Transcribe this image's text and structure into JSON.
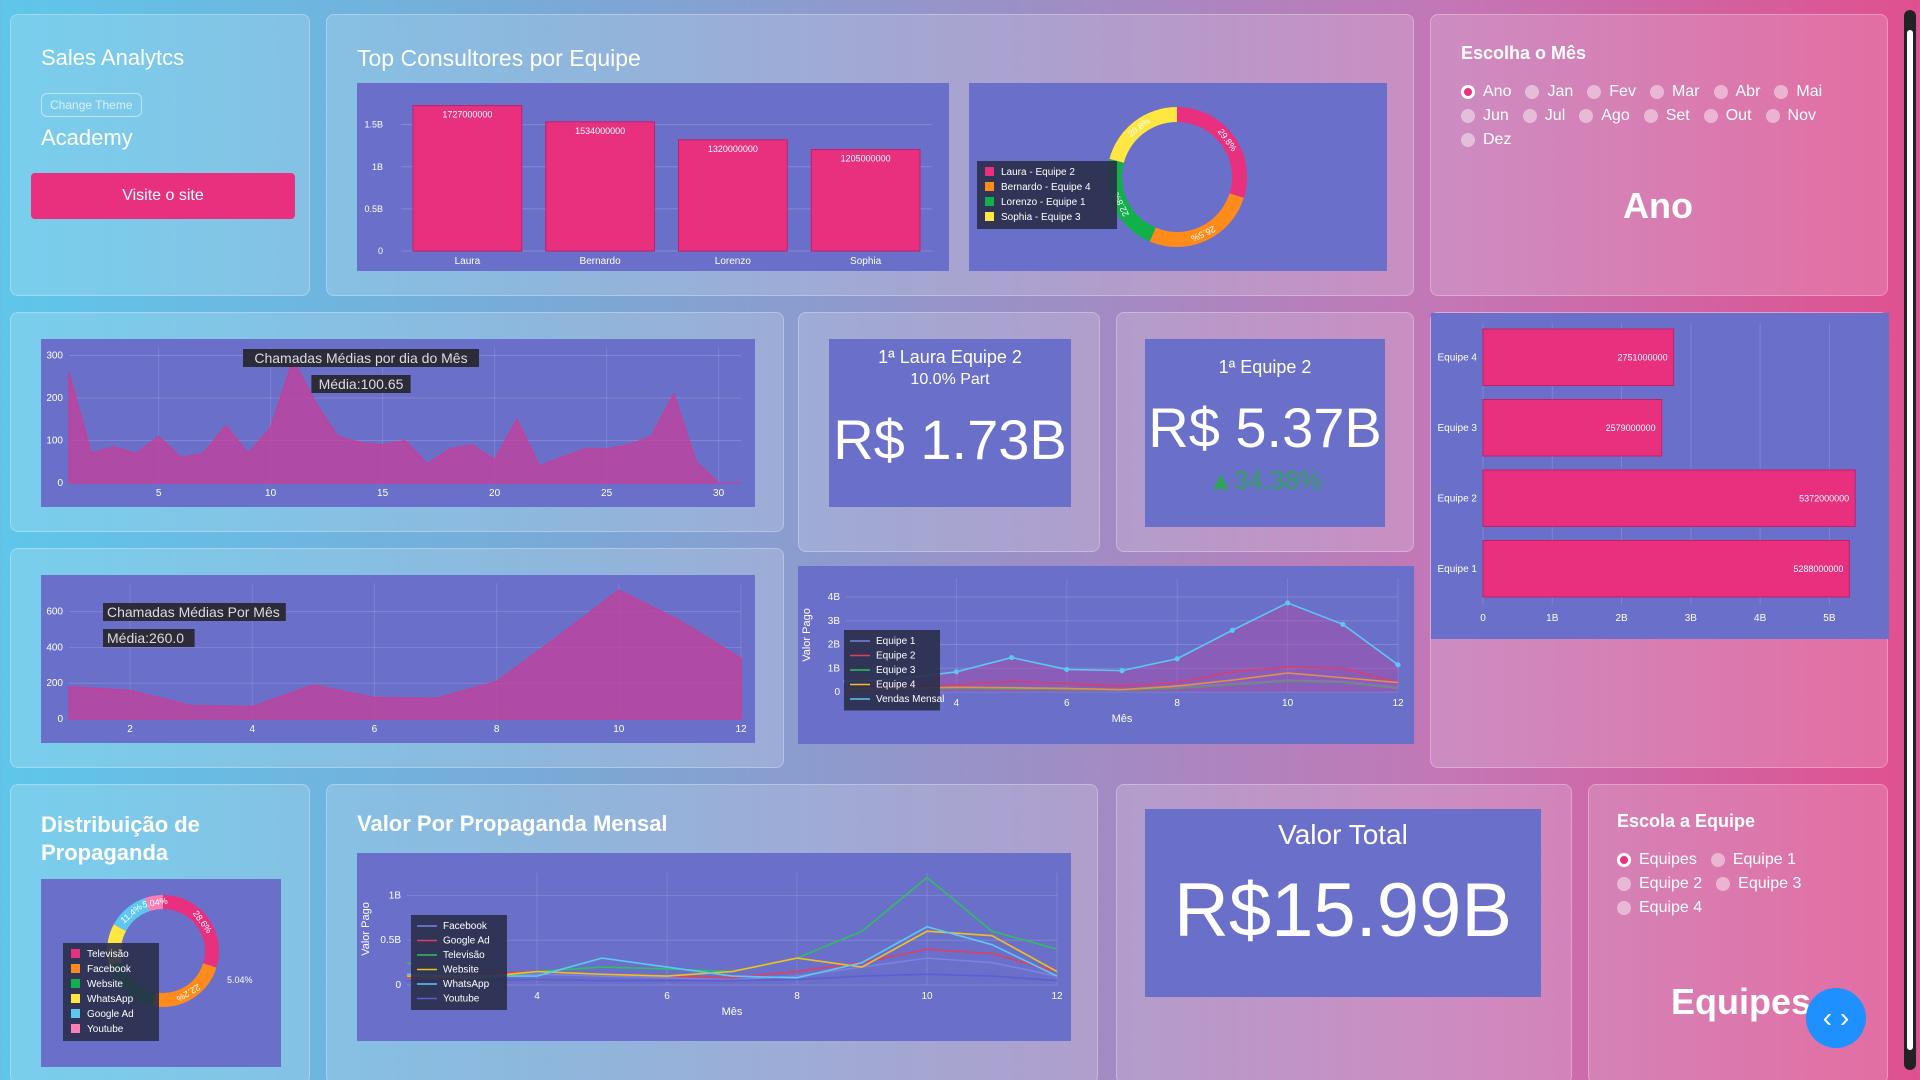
{
  "sidebar": {
    "app_title": "Sales Analytcs",
    "theme_button": "Change Theme",
    "academy": "Academy",
    "visit_button": "Visite o site"
  },
  "top_consultants": {
    "title": "Top Consultores por Equipe",
    "chart_data": {
      "type": "bar",
      "categories": [
        "Laura",
        "Bernardo",
        "Lorenzo",
        "Sophia"
      ],
      "values": [
        1727000000,
        1534000000,
        1320000000,
        1205000000
      ],
      "labels": [
        "1727000000",
        "1534000000",
        "1320000000",
        "1205000000"
      ],
      "yticks": [
        "0",
        "0.5B",
        "1B",
        "1.5B"
      ],
      "ylim": [
        0,
        1900000000
      ],
      "color": "#e8307f"
    }
  },
  "team_share": {
    "chart_data": {
      "type": "pie",
      "labels": [
        "Laura - Equipe 2",
        "Bernardo - Equipe 4",
        "Lorenzo - Equipe 1",
        "Sophia - Equipe 3"
      ],
      "values": [
        29.8,
        26.5,
        22.8,
        20.8
      ],
      "pct": [
        "29.8%",
        "26.5%",
        "22.8%",
        "20.8%"
      ],
      "colors": [
        "#e8307f",
        "#ff8c1a",
        "#12b04a",
        "#ffe640"
      ]
    }
  },
  "month_filter": {
    "title": "Escolha o Mês",
    "options": [
      "Ano",
      "Jan",
      "Fev",
      "Mar",
      "Abr",
      "Mai",
      "Jun",
      "Jul",
      "Ago",
      "Set",
      "Out",
      "Nov",
      "Dez"
    ],
    "selected": "Ano",
    "big_label": "Ano"
  },
  "calls_day": {
    "title": "Chamadas Médias por dia do Mês",
    "avg": "Média:100.65",
    "chart_data": {
      "type": "area",
      "x": [
        1,
        2,
        3,
        4,
        5,
        6,
        7,
        8,
        9,
        10,
        11,
        12,
        13,
        14,
        15,
        16,
        17,
        18,
        19,
        20,
        21,
        22,
        23,
        24,
        25,
        26,
        27,
        28,
        29,
        30,
        31
      ],
      "y": [
        260,
        70,
        85,
        70,
        110,
        60,
        70,
        135,
        70,
        130,
        290,
        190,
        110,
        95,
        90,
        100,
        45,
        80,
        90,
        55,
        150,
        40,
        60,
        80,
        80,
        90,
        110,
        210,
        50,
        0,
        0
      ],
      "xticks": [
        5,
        10,
        15,
        20,
        25,
        30
      ],
      "yticks": [
        0,
        100,
        200,
        300
      ],
      "ylim": [
        0,
        320
      ]
    }
  },
  "calls_month": {
    "title": "Chamadas Médias Por Mês",
    "avg": "Média:260.0",
    "chart_data": {
      "type": "area",
      "x": [
        1,
        2,
        3,
        4,
        5,
        6,
        7,
        8,
        9,
        10,
        11,
        12
      ],
      "y": [
        180,
        160,
        75,
        70,
        190,
        120,
        115,
        210,
        460,
        720,
        550,
        340
      ],
      "xticks": [
        2,
        4,
        6,
        8,
        10,
        12
      ],
      "yticks": [
        0,
        200,
        400,
        600
      ],
      "ylim": [
        0,
        760
      ]
    }
  },
  "kpi_top": {
    "line1": "1ª Laura Equipe 2",
    "line2": "10.0% Part",
    "value": "R$ 1.73B"
  },
  "kpi_team": {
    "line1": "1ª Equipe 2",
    "value": "R$ 5.37B",
    "delta": "▲34.38%"
  },
  "team_bars": {
    "chart_data": {
      "type": "bar",
      "orientation": "horizontal",
      "categories": [
        "Equipe 4",
        "Equipe 3",
        "Equipe 2",
        "Equipe 1"
      ],
      "values": [
        2751000000,
        2579000000,
        5372000000,
        5288000000
      ],
      "labels": [
        "2751000000",
        "2579000000",
        "5372000000",
        "5288000000"
      ],
      "xticks": [
        "0",
        "1B",
        "2B",
        "3B",
        "4B",
        "5B"
      ],
      "xlim": [
        0,
        5600000000
      ]
    }
  },
  "monthly_sales": {
    "ylabel": "Valor Pago",
    "xlabel": "Mês",
    "chart_data": {
      "type": "line",
      "x": [
        1,
        2,
        3,
        4,
        5,
        6,
        7,
        8,
        9,
        10,
        11,
        12
      ],
      "yticks": [
        "0",
        "1B",
        "2B",
        "3B",
        "4B"
      ],
      "xticks": [
        4,
        6,
        8,
        10,
        12
      ],
      "ylim": [
        0,
        4800000000
      ],
      "series": [
        {
          "name": "Equipe 1",
          "color": "#7b83e0",
          "values": [
            0.15,
            0.1,
            0.12,
            0.2,
            0.15,
            0.12,
            0.1,
            0.2,
            0.35,
            0.5,
            0.45,
            0.2
          ]
        },
        {
          "name": "Equipe 2",
          "color": "#e04060",
          "values": [
            0.2,
            0.15,
            0.2,
            0.3,
            0.45,
            0.35,
            0.25,
            0.4,
            0.85,
            1.05,
            1.0,
            0.4
          ]
        },
        {
          "name": "Equipe 3",
          "color": "#2fbf5f",
          "values": [
            0.1,
            0.08,
            0.1,
            0.15,
            0.12,
            0.1,
            0.08,
            0.15,
            0.3,
            0.45,
            0.4,
            0.15
          ]
        },
        {
          "name": "Equipe 4",
          "color": "#f0c020",
          "values": [
            0.15,
            0.12,
            0.15,
            0.2,
            0.18,
            0.15,
            0.1,
            0.25,
            0.5,
            0.8,
            0.6,
            0.4
          ]
        },
        {
          "name": "Vendas Mensal",
          "color": "#5cc8f0",
          "values": [
            0.6,
            0.45,
            0.55,
            0.85,
            1.45,
            0.95,
            0.9,
            1.4,
            2.6,
            3.75,
            2.85,
            1.15
          ]
        }
      ]
    }
  },
  "ad_distribution": {
    "title": "Distribuição de Propaganda",
    "chart_data": {
      "type": "pie",
      "labels": [
        "Televisão",
        "Facebook",
        "Website",
        "WhatsApp",
        "Google Ad",
        "Youtube"
      ],
      "values": [
        28.6,
        22.2,
        17.2,
        11.6,
        11.4,
        5.04
      ],
      "pct": [
        "28.6%",
        "22.2%",
        "",
        "",
        "11.4%",
        "5.04%"
      ],
      "colors": [
        "#e8307f",
        "#ff8c1a",
        "#12b04a",
        "#ffe640",
        "#5cc8f0",
        "#ff7eb6"
      ]
    }
  },
  "ad_monthly": {
    "title": "Valor Por Propaganda Mensal",
    "ylabel": "Valor Pago",
    "xlabel": "Mês",
    "chart_data": {
      "type": "line",
      "x": [
        1,
        2,
        3,
        4,
        5,
        6,
        7,
        8,
        9,
        10,
        11,
        12
      ],
      "yticks": [
        "0",
        "0.5B",
        "1B"
      ],
      "xticks": [
        4,
        6,
        8,
        10,
        12
      ],
      "ylim": [
        0,
        1250000000
      ],
      "series": [
        {
          "name": "Facebook",
          "color": "#7b83e0",
          "values": [
            0.08,
            0.06,
            0.1,
            0.12,
            0.1,
            0.08,
            0.06,
            0.1,
            0.2,
            0.3,
            0.25,
            0.1
          ]
        },
        {
          "name": "Google Ad",
          "color": "#e04060",
          "values": [
            0.1,
            0.08,
            0.12,
            0.15,
            0.12,
            0.1,
            0.08,
            0.15,
            0.25,
            0.4,
            0.35,
            0.15
          ]
        },
        {
          "name": "Televisão",
          "color": "#2fbf5f",
          "values": [
            0.3,
            0.25,
            0.05,
            0.15,
            0.2,
            0.18,
            0.15,
            0.3,
            0.6,
            1.2,
            0.6,
            0.4
          ]
        },
        {
          "name": "Website",
          "color": "#f0c020",
          "values": [
            0.12,
            0.1,
            0.08,
            0.15,
            0.12,
            0.1,
            0.15,
            0.3,
            0.2,
            0.6,
            0.55,
            0.15
          ]
        },
        {
          "name": "WhatsApp",
          "color": "#5cc8f0",
          "values": [
            0.15,
            0.12,
            0.1,
            0.1,
            0.3,
            0.2,
            0.1,
            0.08,
            0.25,
            0.65,
            0.45,
            0.1
          ]
        },
        {
          "name": "Youtube",
          "color": "#5a5fd0",
          "values": [
            0.05,
            0.05,
            0.05,
            0.06,
            0.05,
            0.05,
            0.05,
            0.06,
            0.1,
            0.12,
            0.1,
            0.05
          ]
        }
      ]
    }
  },
  "total": {
    "title": "Valor Total",
    "value": "R$15.99B"
  },
  "team_filter": {
    "title": "Escola a Equipe",
    "options": [
      "Equipes",
      "Equipe 1",
      "Equipe 2",
      "Equipe 3",
      "Equipe 4"
    ],
    "selected": "Equipes",
    "big_label": "Equipes"
  }
}
